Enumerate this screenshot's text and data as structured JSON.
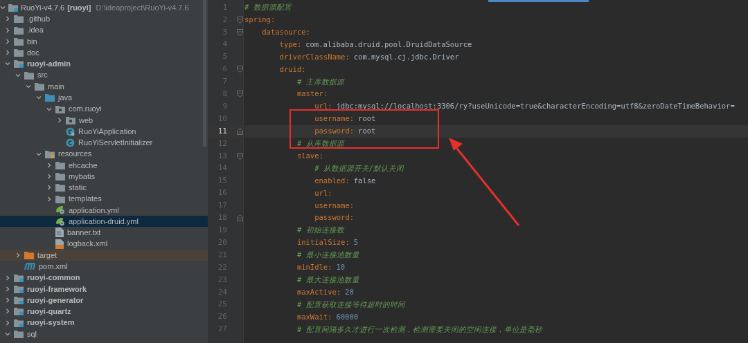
{
  "project_tree": {
    "root": {
      "name": "RuoYi-v4.7.6",
      "tag": "[ruoyi]",
      "path": "D:\\ideaproject\\RuoYi-v4.7.6",
      "expanded": true,
      "selected": false
    },
    "items": [
      {
        "name": ".github",
        "kind": "folder",
        "expanded": false,
        "selected": false
      },
      {
        "name": ".idea",
        "kind": "folder",
        "expanded": false,
        "selected": false
      },
      {
        "name": "bin",
        "kind": "folder",
        "expanded": false,
        "selected": false
      },
      {
        "name": "doc",
        "kind": "folder",
        "expanded": false,
        "selected": false
      },
      {
        "name": "ruoyi-admin",
        "kind": "module",
        "expanded": true,
        "selected": false,
        "children": [
          {
            "name": "src",
            "kind": "folder",
            "expanded": true,
            "selected": false,
            "children": [
              {
                "name": "main",
                "kind": "folder",
                "expanded": true,
                "selected": false,
                "children": [
                  {
                    "name": "java",
                    "kind": "source",
                    "expanded": true,
                    "selected": false,
                    "children": [
                      {
                        "name": "com.ruoyi",
                        "kind": "package",
                        "expanded": true,
                        "selected": false,
                        "children": [
                          {
                            "name": "web",
                            "kind": "package",
                            "expanded": false,
                            "selected": false
                          },
                          {
                            "name": "RuoYiApplication",
                            "kind": "app-class",
                            "selected": false
                          },
                          {
                            "name": "RuoYiServletInitializer",
                            "kind": "class",
                            "selected": false
                          }
                        ]
                      }
                    ]
                  },
                  {
                    "name": "resources",
                    "kind": "resources",
                    "expanded": true,
                    "selected": false,
                    "children": [
                      {
                        "name": "ehcache",
                        "kind": "folder",
                        "expanded": false,
                        "selected": false
                      },
                      {
                        "name": "mybatis",
                        "kind": "folder",
                        "expanded": false,
                        "selected": false
                      },
                      {
                        "name": "static",
                        "kind": "folder",
                        "expanded": false,
                        "selected": false
                      },
                      {
                        "name": "templates",
                        "kind": "folder",
                        "expanded": false,
                        "selected": false
                      },
                      {
                        "name": "application.yml",
                        "kind": "yml",
                        "selected": false
                      },
                      {
                        "name": "application-druid.yml",
                        "kind": "yml",
                        "selected": true
                      },
                      {
                        "name": "banner.txt",
                        "kind": "txt",
                        "selected": false
                      },
                      {
                        "name": "logback.xml",
                        "kind": "xml",
                        "selected": false
                      }
                    ]
                  }
                ]
              }
            ]
          },
          {
            "name": "target",
            "kind": "excluded",
            "expanded": false,
            "selected": false
          },
          {
            "name": "pom.xml",
            "kind": "maven",
            "selected": false
          }
        ]
      },
      {
        "name": "ruoyi-common",
        "kind": "module",
        "expanded": false,
        "selected": false
      },
      {
        "name": "ruoyi-framework",
        "kind": "module",
        "expanded": false,
        "selected": false
      },
      {
        "name": "ruoyi-generator",
        "kind": "module",
        "expanded": false,
        "selected": false
      },
      {
        "name": "ruoyi-quartz",
        "kind": "module",
        "expanded": false,
        "selected": false
      },
      {
        "name": "ruoyi-system",
        "kind": "module",
        "expanded": false,
        "selected": false
      },
      {
        "name": "sql",
        "kind": "folder",
        "expanded": true,
        "selected": false
      }
    ]
  },
  "editor": {
    "lines": [
      {
        "number": "1",
        "comment": "# 数据源配置",
        "current": false
      },
      {
        "number": "2",
        "key": "spring:",
        "current": false,
        "children": [
          {
            "number": "3",
            "key": "datasource:",
            "current": false,
            "children": [
              {
                "number": "4",
                "key": "type:",
                "value": {
                  "text": "com.alibaba.druid.pool.DruidDataSource",
                  "kind": "plain"
                },
                "current": false
              },
              {
                "number": "5",
                "key": "driverClassName:",
                "value": {
                  "text": "com.mysql.cj.jdbc.Driver",
                  "kind": "plain"
                },
                "current": false
              },
              {
                "number": "6",
                "key": "druid:",
                "current": false,
                "children": [
                  {
                    "number": "7",
                    "comment": "# 主库数据源",
                    "current": false
                  },
                  {
                    "number": "8",
                    "key": "master:",
                    "current": false,
                    "children": [
                      {
                        "number": "9",
                        "key": "url:",
                        "value": {
                          "text": "jdbc:mysql://localhost:3306/ry?useUnicode=true&characterEncoding=utf8&zeroDateTimeBehavior=",
                          "kind": "plain"
                        },
                        "current": false
                      },
                      {
                        "number": "10",
                        "key": "username:",
                        "value": {
                          "text": "root",
                          "kind": "plain"
                        },
                        "current": false
                      },
                      {
                        "number": "11",
                        "key": "password:",
                        "value": {
                          "text": "root",
                          "kind": "plain"
                        },
                        "current": true
                      }
                    ]
                  },
                  {
                    "number": "12",
                    "comment": "# 从库数据源",
                    "current": false
                  },
                  {
                    "number": "13",
                    "key": "slave:",
                    "current": false,
                    "children": [
                      {
                        "number": "14",
                        "comment": "# 从数据源开关/默认关闭",
                        "current": false
                      },
                      {
                        "number": "15",
                        "key": "enabled:",
                        "value": {
                          "text": "false",
                          "kind": "plain"
                        },
                        "current": false
                      },
                      {
                        "number": "16",
                        "key": "url:",
                        "current": false
                      },
                      {
                        "number": "17",
                        "key": "username:",
                        "current": false
                      },
                      {
                        "number": "18",
                        "key": "password:",
                        "current": false
                      }
                    ]
                  },
                  {
                    "number": "19",
                    "comment": "# 初始连接数",
                    "current": false
                  },
                  {
                    "number": "20",
                    "key": "initialSize:",
                    "value": {
                      "text": "5",
                      "kind": "number"
                    },
                    "current": false
                  },
                  {
                    "number": "21",
                    "comment": "# 最小连接池数量",
                    "current": false
                  },
                  {
                    "number": "22",
                    "key": "minIdle:",
                    "value": {
                      "text": "10",
                      "kind": "number"
                    },
                    "current": false
                  },
                  {
                    "number": "23",
                    "comment": "# 最大连接池数量",
                    "current": false
                  },
                  {
                    "number": "24",
                    "key": "maxActive:",
                    "value": {
                      "text": "20",
                      "kind": "number"
                    },
                    "current": false
                  },
                  {
                    "number": "25",
                    "comment": "# 配置获取连接等待超时的时间",
                    "current": false
                  },
                  {
                    "number": "26",
                    "key": "maxWait:",
                    "value": {
                      "text": "60000",
                      "kind": "number"
                    },
                    "current": false
                  },
                  {
                    "number": "27",
                    "comment": "# 配置间隔多久才进行一次检测，检测需要关闭的空闲连接，单位是毫秒",
                    "current": false
                  }
                ]
              }
            ]
          }
        ]
      }
    ]
  }
}
